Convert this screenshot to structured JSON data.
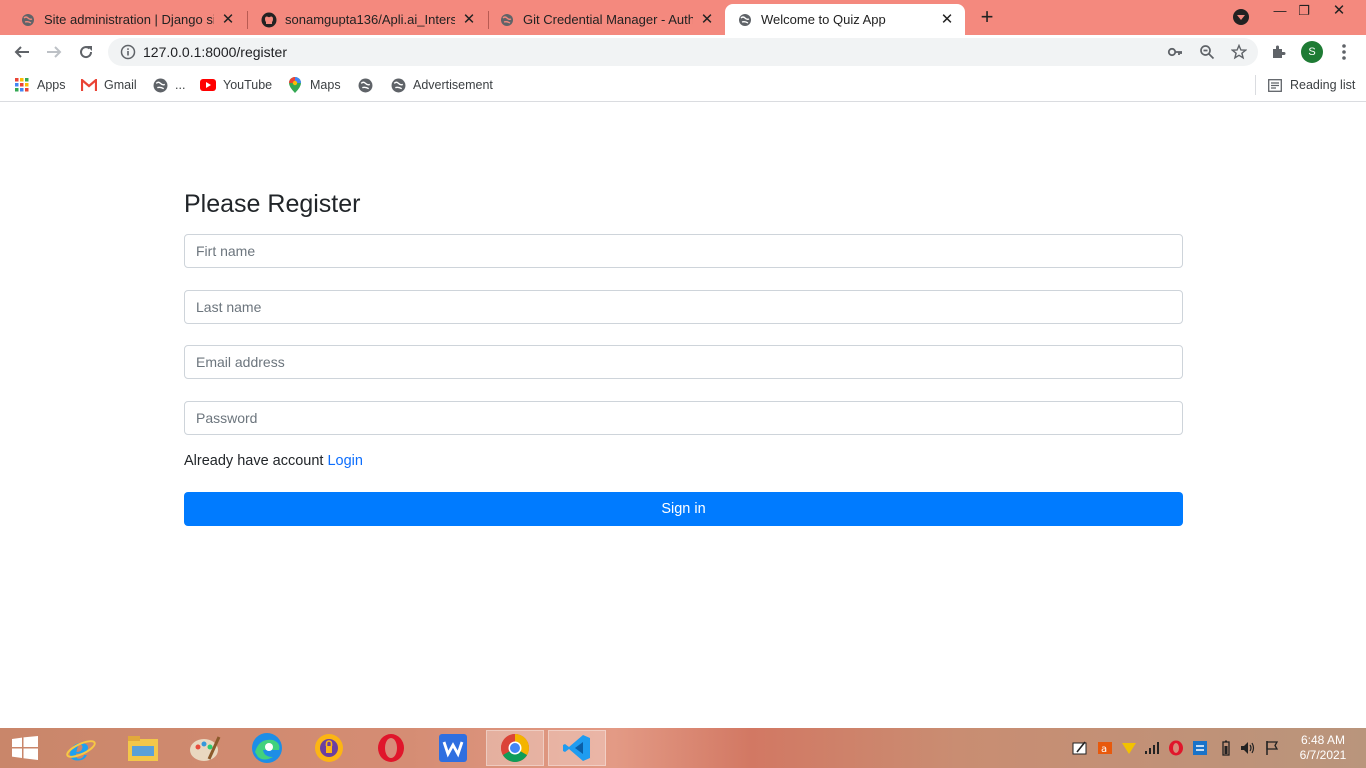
{
  "browser": {
    "tabs": [
      {
        "title": "Site administration | Django site admin",
        "icon": "globe-icon",
        "active": false
      },
      {
        "title": "sonamgupta136/Apli.ai_Intership",
        "icon": "github-icon",
        "active": false
      },
      {
        "title": "Git Credential Manager - Authentication",
        "icon": "globe-icon",
        "active": false
      },
      {
        "title": "Welcome to Quiz App",
        "icon": "globe-icon",
        "active": true
      }
    ],
    "url": "127.0.0.1:8000/register",
    "profile_initial": "S",
    "colors": {
      "tabstrip": "#f4897e",
      "profile": "#1e7b34"
    }
  },
  "bookmarks": {
    "items": [
      {
        "label": "Apps",
        "icon": "apps-grid-icon"
      },
      {
        "label": "Gmail",
        "icon": "gmail-icon"
      },
      {
        "label": "...",
        "icon": "globe-icon"
      },
      {
        "label": "YouTube",
        "icon": "youtube-icon"
      },
      {
        "label": "Maps",
        "icon": "maps-pin-icon"
      },
      {
        "label": "",
        "icon": "globe-icon"
      },
      {
        "label": "Advertisement",
        "icon": "globe-icon"
      }
    ],
    "reading_list": "Reading list"
  },
  "page": {
    "heading": "Please Register",
    "fields": {
      "first_name": {
        "placeholder": "Firt name",
        "value": ""
      },
      "last_name": {
        "placeholder": "Last name",
        "value": ""
      },
      "email": {
        "placeholder": "Email address",
        "value": ""
      },
      "password": {
        "placeholder": "Password",
        "value": ""
      }
    },
    "already_text": "Already have account",
    "login_link": "Login",
    "submit_label": "Sign in",
    "colors": {
      "primary": "#007bff",
      "link": "#0d6efd"
    }
  },
  "taskbar": {
    "time": "6:48 AM",
    "date": "6/7/2021",
    "apps": [
      "windows-start-icon",
      "internet-explorer-icon",
      "file-explorer-icon",
      "paint-icon",
      "edge-icon",
      "vpn-icon",
      "opera-icon",
      "wps-office-icon",
      "chrome-icon",
      "vscode-icon"
    ]
  }
}
